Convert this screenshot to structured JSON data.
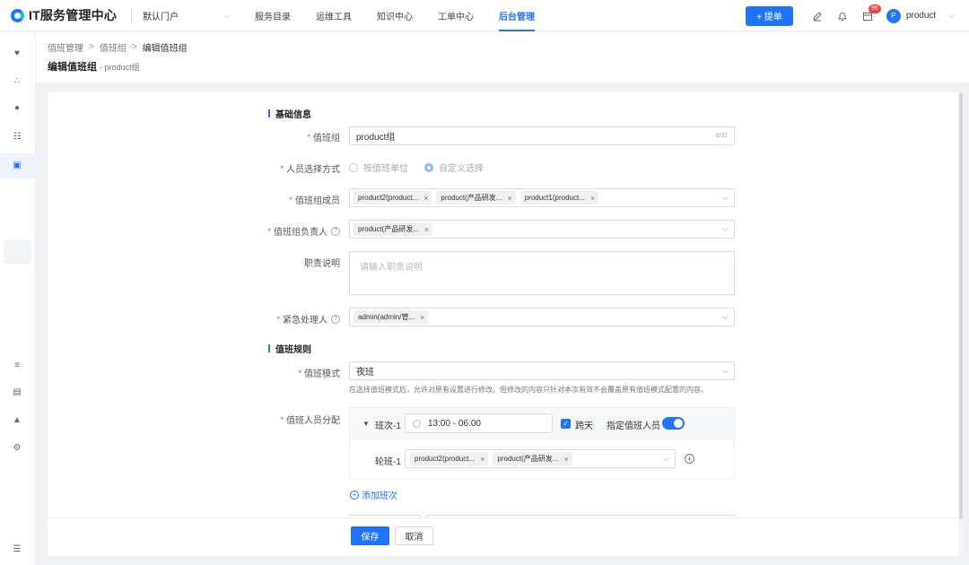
{
  "app": {
    "title": "IT服务管理中心",
    "portal": "默认门户"
  },
  "nav": [
    "服务目录",
    "运维工具",
    "知识中心",
    "工单中心",
    "后台管理"
  ],
  "nav_active_index": 4,
  "topbar": {
    "ticket_button": "+ 提单",
    "badge_count": "96",
    "user_initial": "P",
    "user_name": "product"
  },
  "breadcrumb": [
    "值班管理",
    "值班组",
    "编辑值班组"
  ],
  "page": {
    "title": "编辑值班组",
    "subtitle": "- product组"
  },
  "sections": {
    "basic": "基础信息",
    "rules": "值班规则"
  },
  "labels": {
    "group": "值班组",
    "select_mode": "人员选择方式",
    "members": "值班组成员",
    "leader": "值班组负责人",
    "duty_desc": "职责说明",
    "emergency": "紧急处理人",
    "mode": "值班模式",
    "assign": "值班人员分配"
  },
  "form": {
    "group_value": "product组",
    "group_count": "8/32",
    "select_mode_options": [
      "按值班单位",
      "自定义选择"
    ],
    "select_mode_selected": "自定义选择",
    "members": [
      "product2(product...",
      "product(产品研发...",
      "product1(product..."
    ],
    "leader": [
      "product(产品研发..."
    ],
    "duty_placeholder": "请输入职责说明",
    "emergency": [
      "admin(admin/管..."
    ],
    "mode_value": "夜班",
    "mode_hint": "在选择值班模式后，允许对原有设置进行修改。但修改的内容只针对本次有效不会覆盖原有值班模式配置的内容。"
  },
  "shift": {
    "name": "班次-1",
    "time": "13:00 - 06:00",
    "cross_day_label": "跨天",
    "cross_day_checked": true,
    "assign_label": "指定值班人员",
    "assign_on": true,
    "rotation_label": "轮班-1",
    "rotation_members": [
      "product2(product...",
      "product(产品研发..."
    ],
    "add_shift": "添加班次"
  },
  "buttons": {
    "save": "保存",
    "cancel": "取消"
  },
  "colors": {
    "primary": "#1f74ff",
    "required": "#f04040"
  }
}
